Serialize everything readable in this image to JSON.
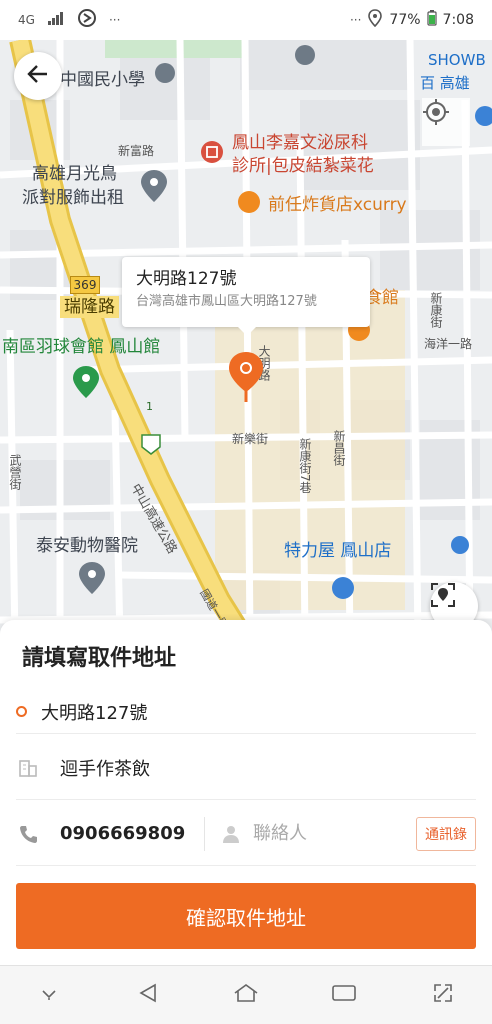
{
  "status_bar": {
    "network": "4G",
    "more": "···",
    "more_right": "···",
    "battery": "77%",
    "time": "7:08"
  },
  "map": {
    "labels": {
      "school": "中國民小學",
      "showbiz": "SHOWB",
      "baihui": "百  高雄",
      "xinfu_road": "新富路",
      "clinic_line1": "鳳山李嘉文泌尿科",
      "clinic_line2": "診所|包皮結紮菜花",
      "party_line1": "高雄月光鳥",
      "party_line2": "派對服飾出租",
      "fried_shop": "前任炸貨店xcurry",
      "route_no": "369",
      "ruilong_road": "瑞隆路",
      "old_food": "老爺美食館",
      "xinkang_st": "新康街",
      "haiyang_road": "海洋一路",
      "badminton": "南區羽球會館 鳳山館",
      "daming_road": "大明路",
      "xinle_st": "新樂街",
      "xinkang_lane": "新康街7巷",
      "xinju_st": "新昌街",
      "wuying_st": "武營街",
      "zhongshan_hwy": "中山高速公路",
      "taian_vet": "泰安動物醫院",
      "tesco": "特力屋 鳳山店",
      "national_1": "國道一號",
      "highway_no": "1"
    },
    "callout": {
      "title": "大明路127號",
      "subtitle": "台灣高雄市鳳山區大明路127號"
    },
    "icons": {
      "back": "arrow-left-icon",
      "locate": "crosshair-icon",
      "scan": "scan-location-icon"
    }
  },
  "panel": {
    "title": "請填寫取件地址",
    "address": "大明路127號",
    "shop_name": "迴手作茶飲",
    "phone": "0906669809",
    "contact_placeholder": "聯絡人",
    "addressbook_label": "通訊錄",
    "confirm_label": "確認取件地址"
  },
  "colors": {
    "accent": "#ee6b23",
    "highway": "#f5d870",
    "map_bg": "#eceef0"
  }
}
